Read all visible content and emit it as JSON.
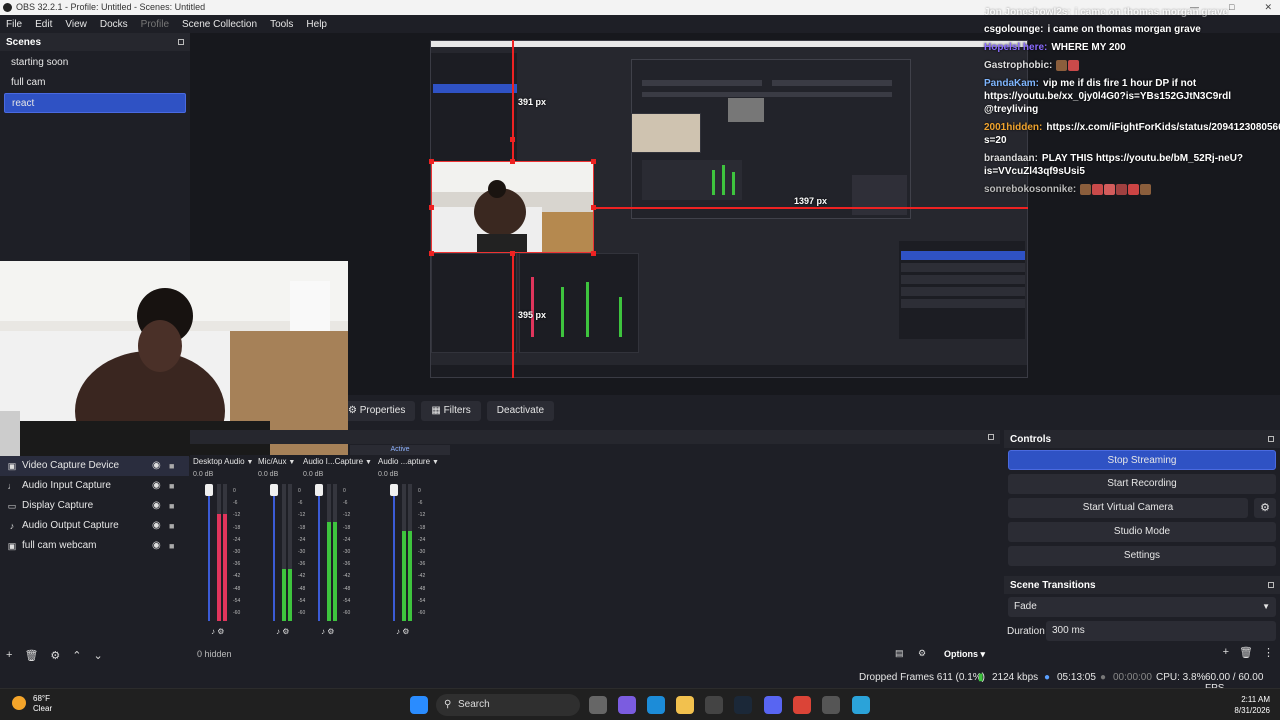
{
  "window": {
    "title": "OBS 32.2.1 - Profile: Untitled - Scenes: Untitled"
  },
  "menu": [
    "File",
    "Edit",
    "View",
    "Docks",
    "Profile",
    "Scene Collection",
    "Tools",
    "Help"
  ],
  "scenes": {
    "title": "Scenes",
    "items": [
      "starting soon",
      "full cam",
      "react"
    ],
    "selected": "react"
  },
  "preview": {
    "dim_width": "391 px",
    "dim_right": "1397 px",
    "dim_bottom": "395 px"
  },
  "chat": [
    {
      "user": "Jon Jonesbowl2s:",
      "text": "i came on thomas morgan grave",
      "user_color": "#ffffff"
    },
    {
      "user": "csgolounge:",
      "text": "i came on thomas morgan grave",
      "user_color": "#ffffff"
    },
    {
      "user": "Hopelsl here:",
      "text": "WHERE MY 200",
      "user_color": "#8a6cff"
    },
    {
      "user": "Gastrophobic:",
      "text": "",
      "user_color": "#dddddd"
    },
    {
      "user": "PandaKam:",
      "text": "vip me if dis fire 1 hour DP if not https://youtu.be/xx_0jy0l4G0?is=YBs152GJtN3C9rdl @treyliving",
      "user_color": "#7fb6ff"
    },
    {
      "user": "2001hidden:",
      "text": "https://x.com/iFightForKids/status/2094123080566079774?s=20",
      "user_color": "#f0a32e"
    },
    {
      "user": "braandaan:",
      "text": "PLAY THIS https://youtu.be/bM_52Rj-neU?is=VVcuZl43qf9sUsi5",
      "user_color": "#dddddd"
    },
    {
      "user": "sonrebokosonnike:",
      "text": "",
      "user_color": "#bbbbbb"
    }
  ],
  "context_bar": {
    "properties": "Properties",
    "filters": "Filters",
    "deactivate": "Deactivate"
  },
  "sources": {
    "items": [
      {
        "name": "Video Capture Device",
        "icon": "camera-icon"
      },
      {
        "name": "Audio Input Capture",
        "icon": "microphone-icon"
      },
      {
        "name": "Display Capture",
        "icon": "monitor-icon"
      },
      {
        "name": "Audio Output Capture",
        "icon": "speaker-icon"
      },
      {
        "name": "full cam webcam",
        "icon": "camera-icon"
      }
    ],
    "selected": "Video Capture Device"
  },
  "mixer": {
    "active_tab": "Active",
    "hidden": "0 hidden",
    "options": "Options",
    "scale": [
      "0",
      "-6",
      "-12",
      "-18",
      "-24",
      "-30",
      "-36",
      "-42",
      "-48",
      "-54",
      "-60"
    ],
    "channels": [
      {
        "name": "Desktop Audio",
        "db": "0.0 dB",
        "level": 0.78,
        "color": "#e0355c"
      },
      {
        "name": "Mic/Aux",
        "db": "0.0 dB",
        "level": 0.38,
        "color": "#3ec43e"
      },
      {
        "name": "Audio I...Capture",
        "db": "0.0 dB",
        "level": 0.72,
        "color": "#3ec43e"
      },
      {
        "name": "Audio ...apture",
        "db": "0.0 dB",
        "level": 0.66,
        "color": "#3ec43e"
      }
    ]
  },
  "controls": {
    "title": "Controls",
    "stop_streaming": "Stop Streaming",
    "start_recording": "Start Recording",
    "start_virtual_camera": "Start Virtual Camera",
    "studio_mode": "Studio Mode",
    "settings": "Settings"
  },
  "transitions": {
    "title": "Scene Transitions",
    "selected": "Fade",
    "duration_label": "Duration",
    "duration": "300 ms"
  },
  "status": {
    "dropped": "Dropped Frames 611 (0.1%)",
    "bitrate": "2124 kbps",
    "stream_time": "05:13:05",
    "rec_time": "00:00:00",
    "cpu": "CPU: 3.8%",
    "fps": "60.00 / 60.00 FPS"
  },
  "taskbar": {
    "temp": "68°F",
    "weather": "Clear",
    "search": "Search",
    "time": "2:11 AM",
    "date": "8/31/2026"
  },
  "colors": {
    "accent": "#2f52c4",
    "selection_red": "#e22222",
    "panel": "#1e1f26"
  }
}
